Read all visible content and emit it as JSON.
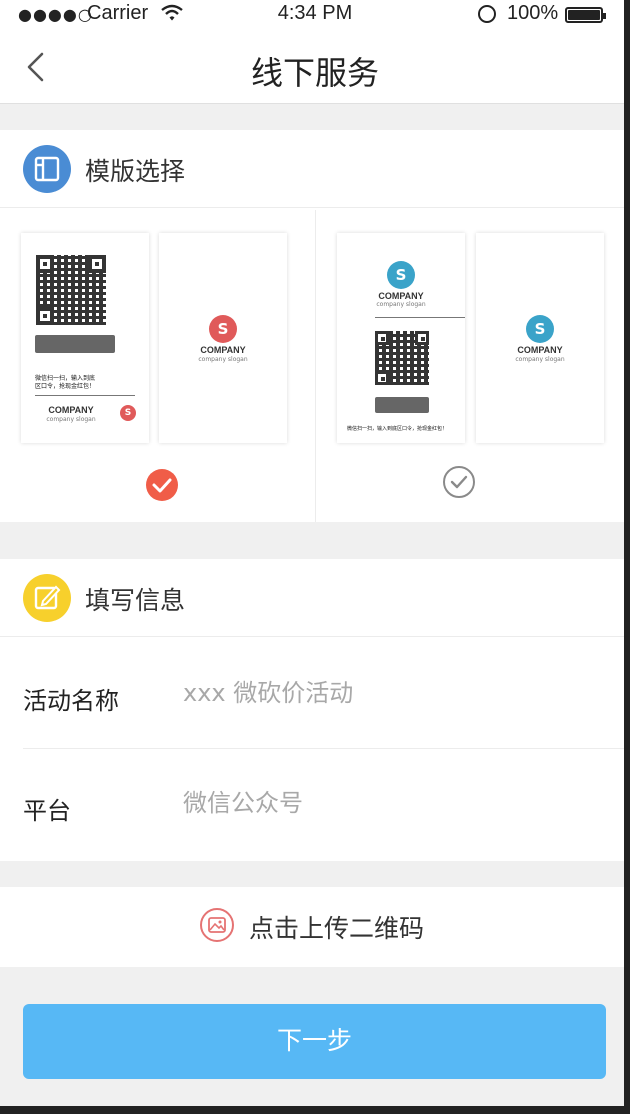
{
  "status_bar": {
    "carrier": "Carrier",
    "time": "4:34 PM",
    "battery": "100%",
    "signal_dots": "●●●●○"
  },
  "nav": {
    "title": "线下服务"
  },
  "template_section": {
    "title": "模版选择",
    "icon": "template-icon",
    "icon_color": "#4a8cd4",
    "templates": [
      {
        "front_text": "微信扫一扫，输入到底区口令，抢现金红包！",
        "company": "COMPANY",
        "slogan": "company slogan",
        "back_company": "COMPANY",
        "back_slogan": "company slogan",
        "logo_color": "#e05a5a",
        "selected": true
      },
      {
        "front_text": "微信扫一扫，输入到底区口令，抢现金红包！",
        "company": "COMPANY",
        "slogan": "company slogan",
        "back_company": "COMPANY",
        "back_slogan": "company slogan",
        "logo_color": "#3aa3c9",
        "selected": false
      }
    ],
    "selected_color": "#f05d48"
  },
  "info_section": {
    "title": "填写信息",
    "icon": "edit-icon",
    "icon_color": "#f7d02c",
    "fields": [
      {
        "label": "活动名称",
        "placeholder": "xxx 微砍价活动"
      },
      {
        "label": "平台",
        "placeholder": "微信公众号"
      }
    ]
  },
  "upload": {
    "label": "点击上传二维码",
    "icon": "image-upload-icon"
  },
  "next_button": {
    "label": "下一步",
    "color": "#57b8f5"
  }
}
